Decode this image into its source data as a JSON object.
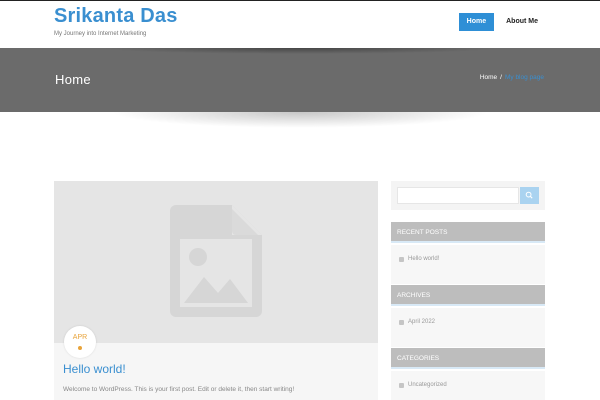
{
  "site": {
    "title": "Srikanta Das",
    "tagline": "My Journey into Internet Marketing"
  },
  "nav": {
    "items": [
      {
        "label": "Home",
        "active": true
      },
      {
        "label": "About Me",
        "active": false
      }
    ]
  },
  "banner": {
    "heading": "Home",
    "breadcrumb": {
      "home": "Home",
      "separator": "/",
      "current": "My blog page"
    }
  },
  "post": {
    "date_month": "APR",
    "title": "Hello world!",
    "excerpt": "Welcome to WordPress. This is your first post. Edit or delete it, then start writing!"
  },
  "sidebar": {
    "search": {
      "placeholder": ""
    },
    "widgets": [
      {
        "title": "RECENT POSTS",
        "items": [
          "Hello world!"
        ]
      },
      {
        "title": "ARCHIVES",
        "items": [
          "April 2022"
        ]
      },
      {
        "title": "CATEGORIES",
        "items": [
          "Uncategorized"
        ]
      }
    ]
  },
  "colors": {
    "accent": "#2e8fd6",
    "banner": "#6b6b6b",
    "widget_header": "#bdbdbd",
    "date_accent": "#e8a33a"
  }
}
